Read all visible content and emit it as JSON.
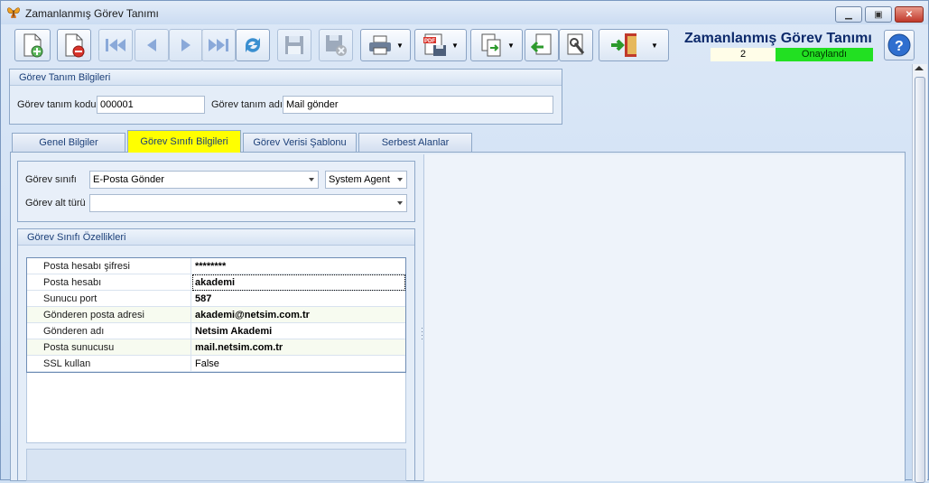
{
  "window": {
    "title": "Zamanlanmış Görev Tanımı",
    "icon": "butterfly-icon"
  },
  "header": {
    "title": "Zamanlanmış Görev Tanımı",
    "count": "2",
    "status": "Onaylandı",
    "status_color": "#22e022"
  },
  "toolbar": {
    "buttons": [
      "new-document-icon",
      "delete-document-icon",
      "first-record-icon",
      "previous-record-icon",
      "next-record-icon",
      "last-record-icon",
      "refresh-icon",
      "save-icon",
      "cancel-save-icon",
      "print-icon",
      "pdf-export-icon",
      "copy-icon",
      "import-icon",
      "settings-wrench-icon",
      "exit-door-icon",
      "help-icon"
    ]
  },
  "definition": {
    "group_title": "Görev Tanım Bilgileri",
    "code_label": "Görev tanım kodu",
    "code_value": "000001",
    "name_label": "Görev tanım adı",
    "name_value": "Mail gönder"
  },
  "tabs": [
    {
      "label": "Genel Bilgiler"
    },
    {
      "label": "Görev Sınıfı Bilgileri"
    },
    {
      "label": "Görev Verisi Şablonu"
    },
    {
      "label": "Serbest Alanlar"
    }
  ],
  "task_class": {
    "class_label": "Görev sınıfı",
    "class_value": "E-Posta Gönder",
    "agent_value": "System Agent",
    "subtype_label": "Görev alt türü",
    "subtype_value": ""
  },
  "properties": {
    "group_title": "Görev Sınıfı Özellikleri",
    "rows": [
      {
        "key": "Posta hesabı şifresi",
        "value": "********"
      },
      {
        "key": "Posta hesabı",
        "value": "akademi"
      },
      {
        "key": "Sunucu port",
        "value": "587"
      },
      {
        "key": "Gönderen posta adresi",
        "value": "akademi@netsim.com.tr"
      },
      {
        "key": "Gönderen adı",
        "value": "Netsim Akademi"
      },
      {
        "key": "Posta sunucusu",
        "value": "mail.netsim.com.tr"
      },
      {
        "key": "SSL kullan",
        "value": "False"
      }
    ]
  }
}
